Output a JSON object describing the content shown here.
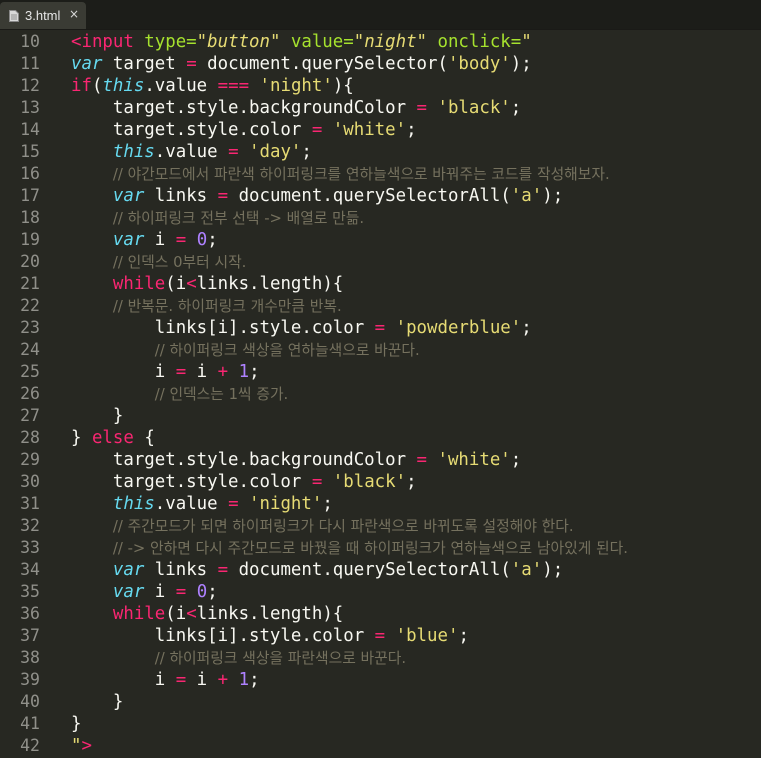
{
  "tab": {
    "title": "3.html",
    "close": "×"
  },
  "line_numbers": [
    "10",
    "11",
    "12",
    "13",
    "14",
    "15",
    "16",
    "17",
    "18",
    "19",
    "20",
    "21",
    "22",
    "23",
    "24",
    "25",
    "26",
    "27",
    "28",
    "29",
    "30",
    "31",
    "32",
    "33",
    "34",
    "35",
    "36",
    "37",
    "38",
    "39",
    "40",
    "41",
    "42"
  ],
  "code": {
    "l10": {
      "a": "<input",
      "b": " type=",
      "c": "\"button\"",
      "d": " value=",
      "e": "\"night\"",
      "f": " onclick=",
      "g": "\""
    },
    "l11": {
      "kw": "var",
      "a": " target ",
      "op": "=",
      "b": " document.querySelector(",
      "s": "'body'",
      "c": ");"
    },
    "l12": {
      "kw": "if",
      "a": "(",
      "kw2": "this",
      "b": ".value ",
      "op": "===",
      "c": " ",
      "s": "'night'",
      "d": "){"
    },
    "l13": {
      "a": "    target.style.backgroundColor ",
      "op": "=",
      "b": " ",
      "s": "'black'",
      "c": ";"
    },
    "l14": {
      "a": "    target.style.color ",
      "op": "=",
      "b": " ",
      "s": "'white'",
      "c": ";"
    },
    "l15": {
      "a": "    ",
      "kw": "this",
      "b": ".value ",
      "op": "=",
      "c": " ",
      "s": "'day'",
      "d": ";"
    },
    "l16": {
      "a": "    ",
      "cm": "// 야간모드에서 파란색 하이퍼링크를 연하늘색으로 바꿔주는 코드를 작성해보자."
    },
    "l17": {
      "a": "    ",
      "kw": "var",
      "b": " links ",
      "op": "=",
      "c": " document.querySelectorAll(",
      "s": "'a'",
      "d": ");"
    },
    "l18": {
      "a": "    ",
      "cm": "// 하이퍼링크 전부 선택 -> 배열로 만듦."
    },
    "l19": {
      "a": "    ",
      "kw": "var",
      "b": " i ",
      "op": "=",
      "c": " ",
      "n": "0",
      "d": ";"
    },
    "l20": {
      "a": "    ",
      "cm": "// 인덱스 0부터 시작."
    },
    "l21": {
      "a": "    ",
      "kw": "while",
      "b": "(i",
      "op": "<",
      "c": "links.length){"
    },
    "l22": {
      "a": "    ",
      "cm": "// 반복문. 하이퍼링크 개수만큼 반복."
    },
    "l23": {
      "a": "        links[i].style.color ",
      "op": "=",
      "b": " ",
      "s": "'powderblue'",
      "c": ";"
    },
    "l24": {
      "a": "        ",
      "cm": "// 하이퍼링크 색상을 연하늘색으로 바꾼다."
    },
    "l25": {
      "a": "        i ",
      "op": "=",
      "b": " i ",
      "op2": "+",
      "c": " ",
      "n": "1",
      "d": ";"
    },
    "l26": {
      "a": "        ",
      "cm": "// 인덱스는 1씩 증가."
    },
    "l27": {
      "a": "    }"
    },
    "l28": {
      "a": "} ",
      "kw": "else",
      "b": " {"
    },
    "l29": {
      "a": "    target.style.backgroundColor ",
      "op": "=",
      "b": " ",
      "s": "'white'",
      "c": ";"
    },
    "l30": {
      "a": "    target.style.color ",
      "op": "=",
      "b": " ",
      "s": "'black'",
      "c": ";"
    },
    "l31": {
      "a": "    ",
      "kw": "this",
      "b": ".value ",
      "op": "=",
      "c": " ",
      "s": "'night'",
      "d": ";"
    },
    "l32": {
      "a": "    ",
      "cm": "// 주간모드가 되면 하이퍼링크가 다시 파란색으로 바뀌도록 설정해야 한다."
    },
    "l33": {
      "a": "    ",
      "cm": "// -> 안하면 다시 주간모드로 바꿨을 때 하이퍼링크가 연하늘색으로 남아있게 된다."
    },
    "l34": {
      "a": "    ",
      "kw": "var",
      "b": " links ",
      "op": "=",
      "c": " document.querySelectorAll(",
      "s": "'a'",
      "d": ");"
    },
    "l35": {
      "a": "    ",
      "kw": "var",
      "b": " i ",
      "op": "=",
      "c": " ",
      "n": "0",
      "d": ";"
    },
    "l36": {
      "a": "    ",
      "kw": "while",
      "b": "(i",
      "op": "<",
      "c": "links.length){"
    },
    "l37": {
      "a": "        links[i].style.color ",
      "op": "=",
      "b": " ",
      "s": "'blue'",
      "c": ";"
    },
    "l38": {
      "a": "        ",
      "cm": "// 하이퍼링크 색상을 파란색으로 바꾼다."
    },
    "l39": {
      "a": "        i ",
      "op": "=",
      "b": " i ",
      "op2": "+",
      "c": " ",
      "n": "1",
      "d": ";"
    },
    "l40": {
      "a": "    }"
    },
    "l41": {
      "a": "}"
    },
    "l42": {
      "a": "\"",
      "t": ">"
    }
  }
}
